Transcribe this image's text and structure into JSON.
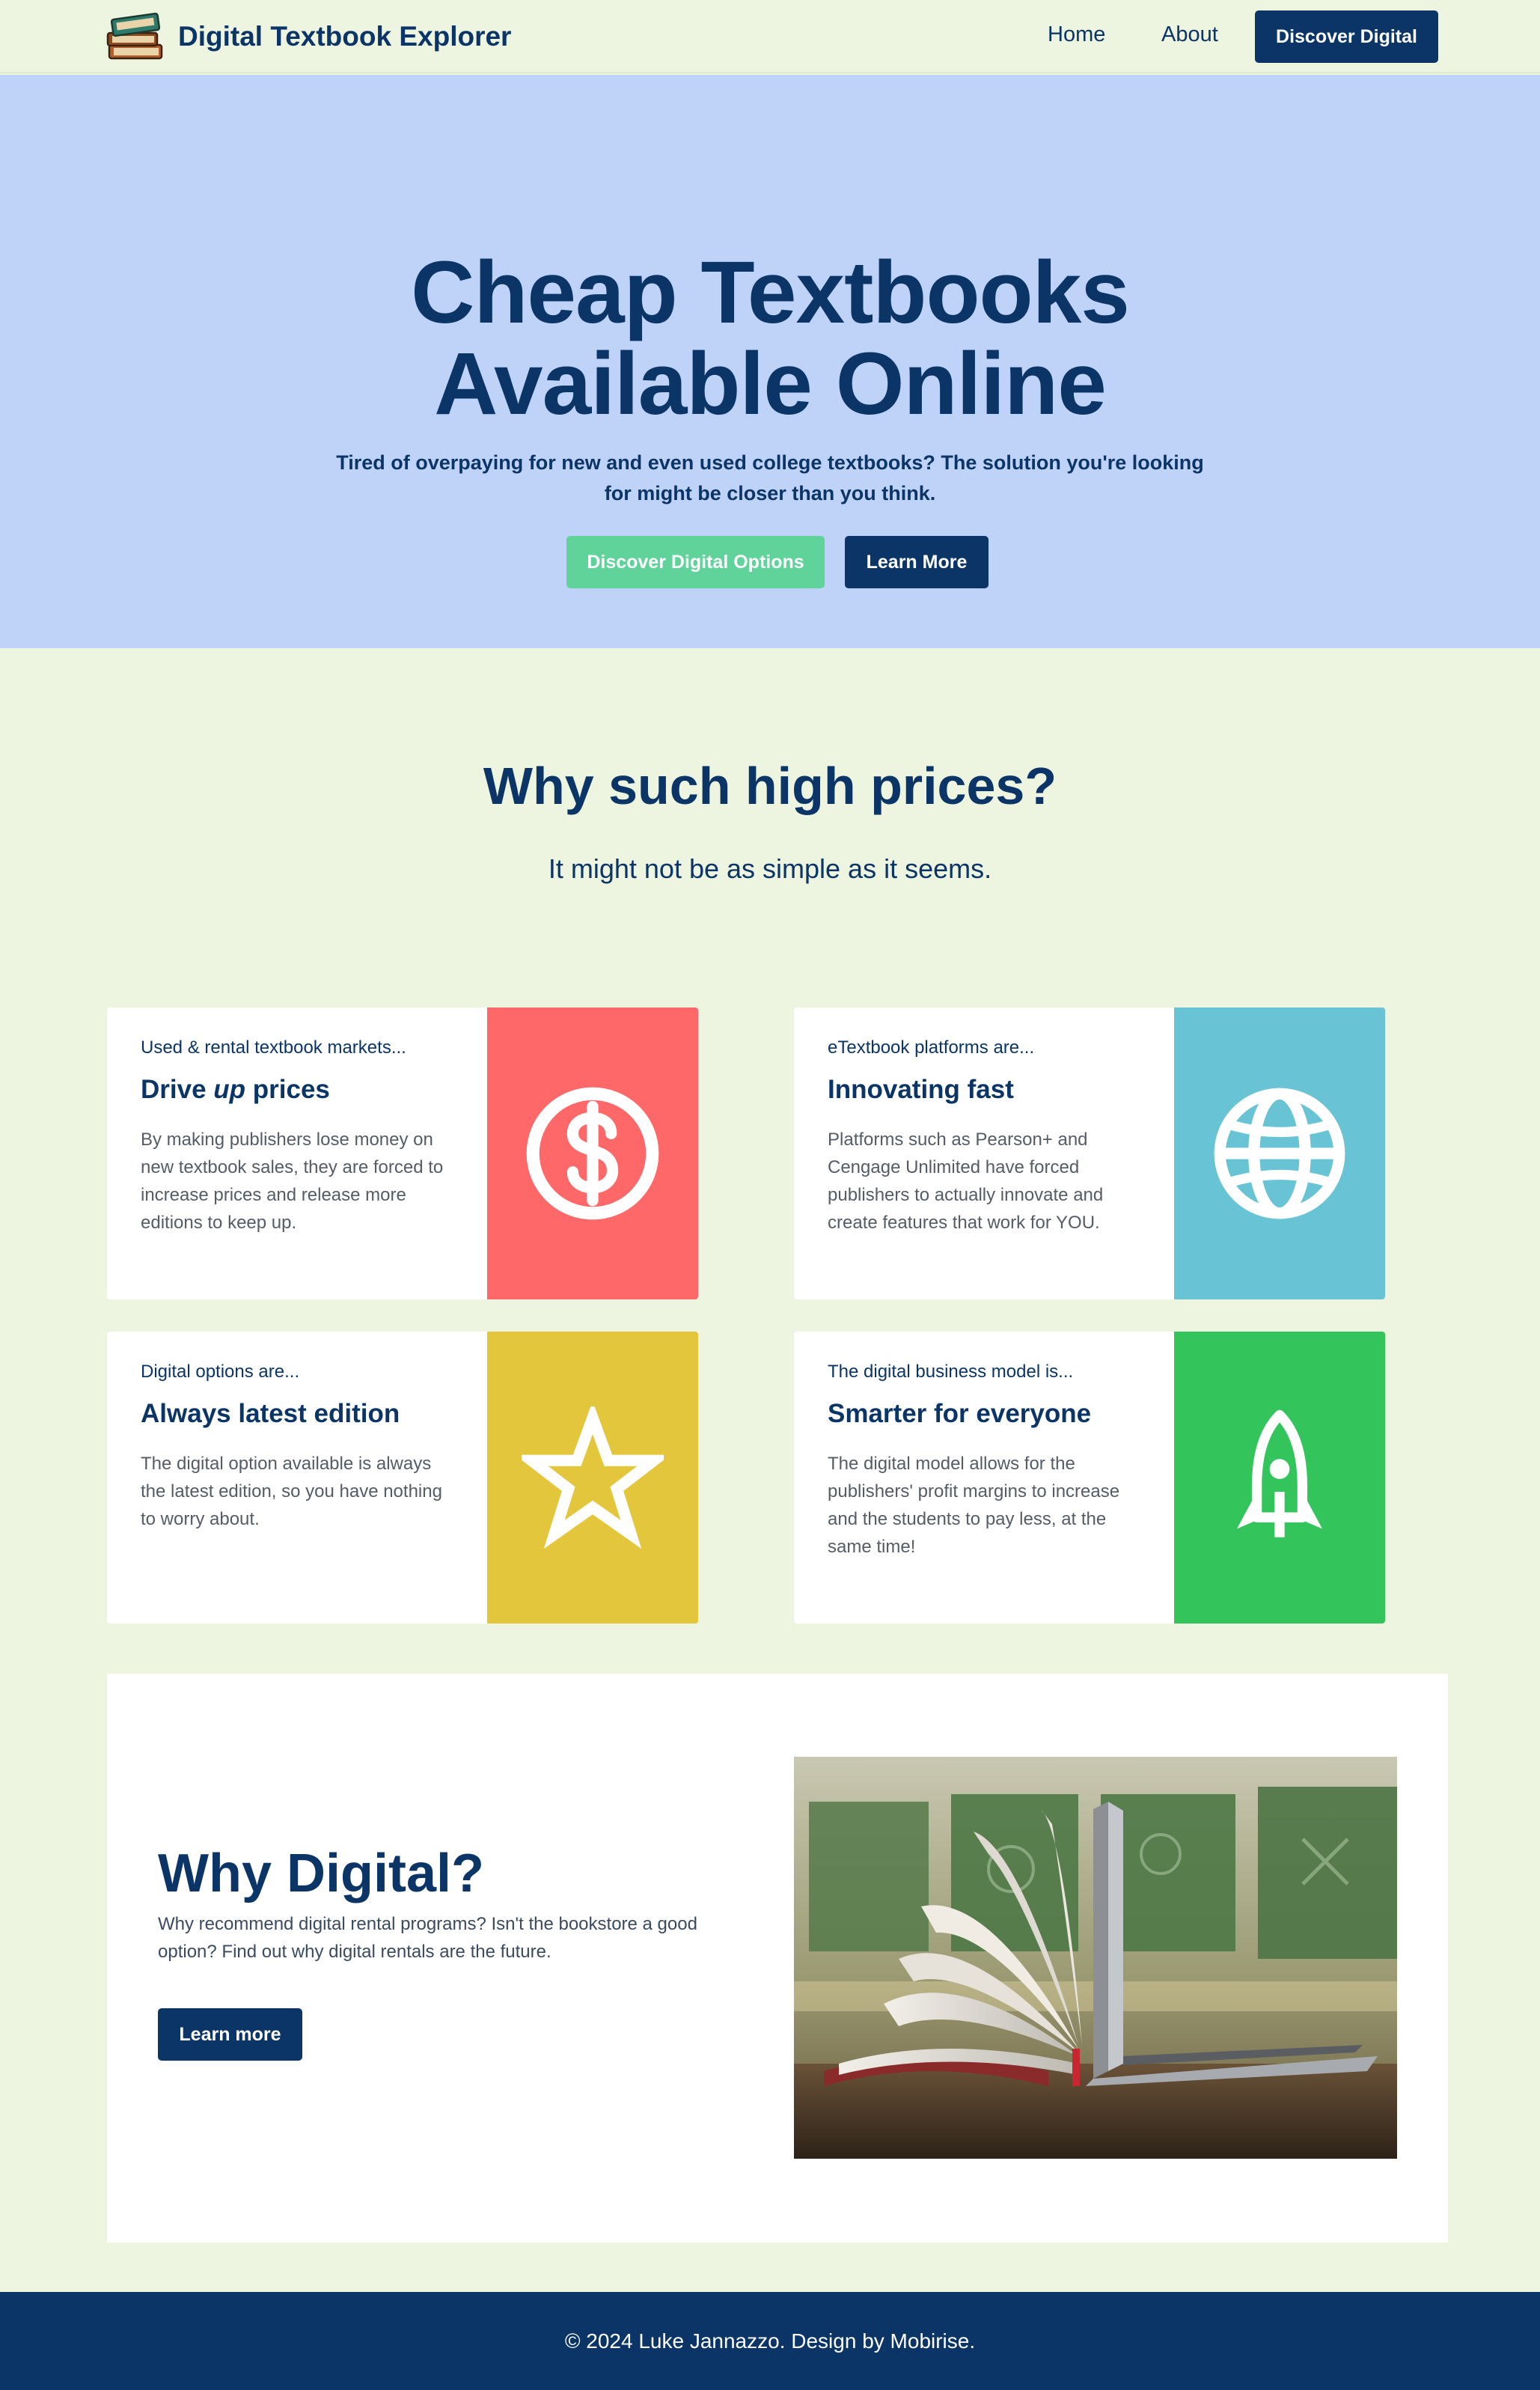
{
  "nav": {
    "brand": "Digital Textbook Explorer",
    "links": [
      "Home",
      "About"
    ],
    "cta": "Discover Digital"
  },
  "hero": {
    "title_line1": "Cheap Textbooks",
    "title_line2": "Available Online",
    "subtitle": "Tired of overpaying for new and even used college textbooks? The solution you're looking for might be closer than you think.",
    "primary_button": "Discover Digital Options",
    "secondary_button": "Learn More"
  },
  "prices": {
    "title": "Why such high prices?",
    "subtitle": "It might not be as simple as it seems."
  },
  "cards": [
    {
      "kicker": "Used & rental textbook markets...",
      "title_pre": "Drive ",
      "title_em": "up",
      "title_post": " prices",
      "desc": "By making publishers lose money on new textbook sales, they are forced to increase prices and release more editions to keep up.",
      "icon": "dollar-icon",
      "color": "#ff6868"
    },
    {
      "kicker": "eTextbook platforms are...",
      "title": "Innovating fast",
      "desc": "Platforms such as Pearson+ and Cengage Unlimited have forced publishers to actually innovate and create features that work for YOU.",
      "icon": "globe-icon",
      "color": "#68c4d4"
    },
    {
      "kicker": "Digital options are...",
      "title": "Always latest edition",
      "desc": "The digital option available is always the latest edition, so you have nothing to worry about.",
      "icon": "star-icon",
      "color": "#e4c63c"
    },
    {
      "kicker": "The digital business model is...",
      "title": "Smarter for everyone",
      "desc": "The digital model allows for the publishers' profit margins to increase and the students to pay less, at the same time!",
      "icon": "rocket-icon",
      "color": "#33c45c"
    }
  ],
  "why": {
    "title": "Why Digital?",
    "desc": "Why recommend digital rental programs? Isn't the bookstore a good option? Find out why digital rentals are the future.",
    "button": "Learn more"
  },
  "footer": {
    "text": "© 2024 Luke Jannazzo. Design by Mobirise."
  }
}
